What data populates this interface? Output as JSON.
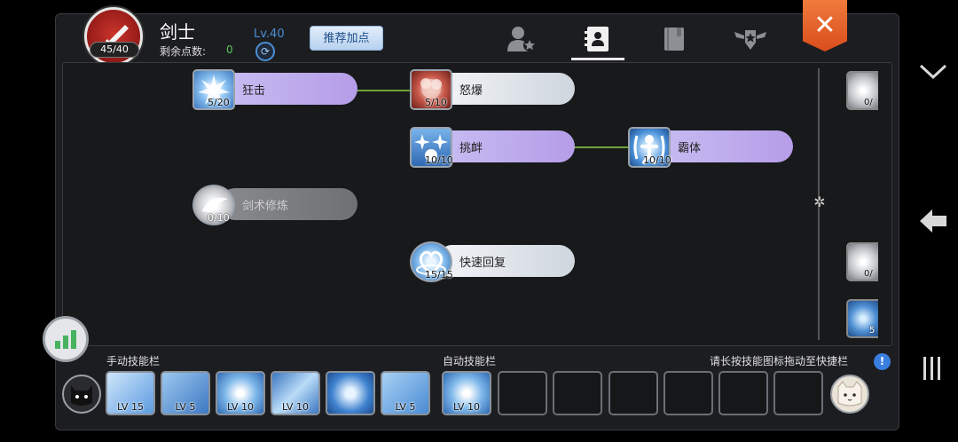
{
  "header": {
    "skill_count": "45/40",
    "class_name": "剑士",
    "points_label": "剩余点数:",
    "points_value": "0",
    "level": "Lv.40",
    "recommend_label": "推荐加点",
    "tabs": [
      {
        "name": "character",
        "icon": "person-star-icon"
      },
      {
        "name": "skills",
        "icon": "contact-book-icon",
        "active": true
      },
      {
        "name": "book",
        "icon": "book-icon"
      },
      {
        "name": "rank",
        "icon": "winged-star-badge-icon"
      }
    ],
    "close_icon": "close-icon"
  },
  "tree": {
    "skills": [
      {
        "name": "狂击",
        "count": "5/20",
        "style": "purple",
        "icon": "burst-sun-icon"
      },
      {
        "name": "怒爆",
        "count": "5/10",
        "style": "white",
        "icon": "rage-explosion-icon"
      },
      {
        "name": "挑衅",
        "count": "10/10",
        "style": "purple",
        "icon": "taunt-sparks-icon"
      },
      {
        "name": "霸体",
        "count": "10/10",
        "style": "purple",
        "icon": "super-armor-icon"
      },
      {
        "name": "剑术修炼",
        "count": "0/10",
        "style": "gray",
        "icon": "sword-mastery-icon"
      },
      {
        "name": "快速回复",
        "count": "15/15",
        "style": "white",
        "icon": "heart-recovery-icon"
      }
    ],
    "side_skills": [
      {
        "count": "0/"
      },
      {
        "count": "0/"
      },
      {
        "count": "5"
      }
    ]
  },
  "bottom": {
    "manual_label": "手动技能栏",
    "auto_label": "自动技能栏",
    "hint": "请长按技能图标拖动至快捷栏",
    "manual_slots": [
      "LV 15",
      "LV 5",
      "LV 10",
      "LV 10",
      "",
      "LV 5"
    ],
    "auto_slots": [
      "LV 10",
      "",
      "",
      "",
      "",
      "",
      ""
    ]
  },
  "colors": {
    "close": "#e35b24",
    "accent_blue": "#4a8fd6",
    "link_green": "#6aa33a"
  }
}
